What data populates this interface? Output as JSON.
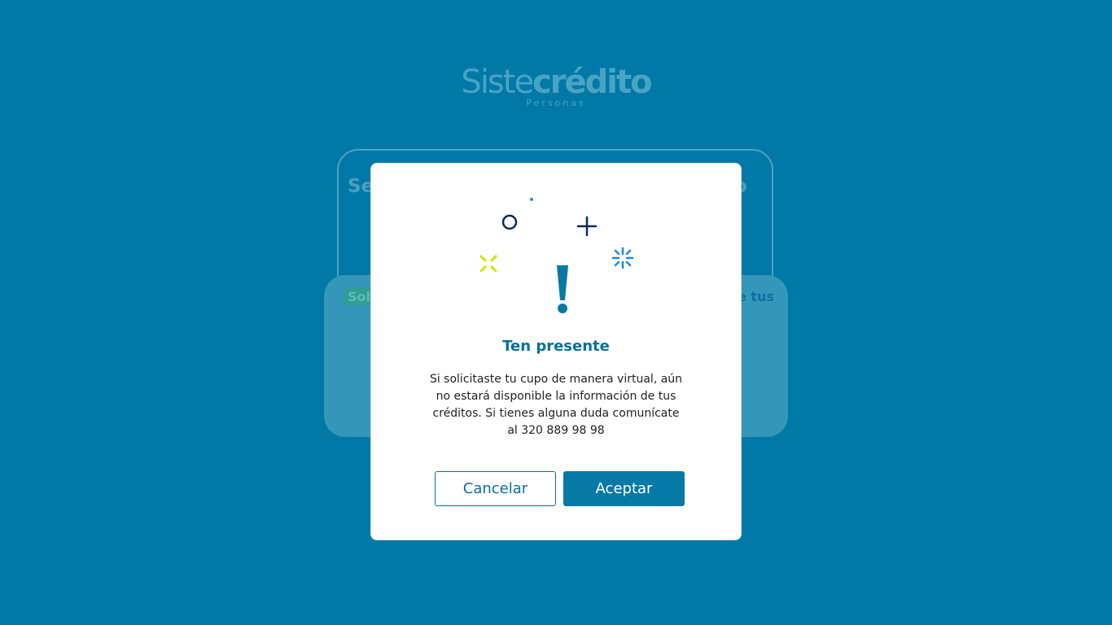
{
  "background": {
    "logo_main_light": "Siste",
    "logo_main_bold": "crédito",
    "logo_sub": "Personas",
    "card_title_left": "Se",
    "card_title_right": "ito",
    "badge_text": "Sol",
    "right_text": "e tus"
  },
  "modal": {
    "title": "Ten presente",
    "message_lines": [
      "Si solicitaste tu cupo de manera virtual, aún",
      "no estará disponible la información de tus",
      "créditos. Si tienes alguna duda comunícate",
      "al 320 889 98 98"
    ],
    "cancel_label": "Cancelar",
    "accept_label": "Aceptar"
  },
  "colors": {
    "page_background": "#0079a7",
    "primary": "#0779a5",
    "accent_yellow": "#c8e600",
    "accent_blue": "#1e88e5",
    "dark_navy": "#0b2a5a"
  },
  "icons": {
    "illustration": "exclamation-icon"
  }
}
